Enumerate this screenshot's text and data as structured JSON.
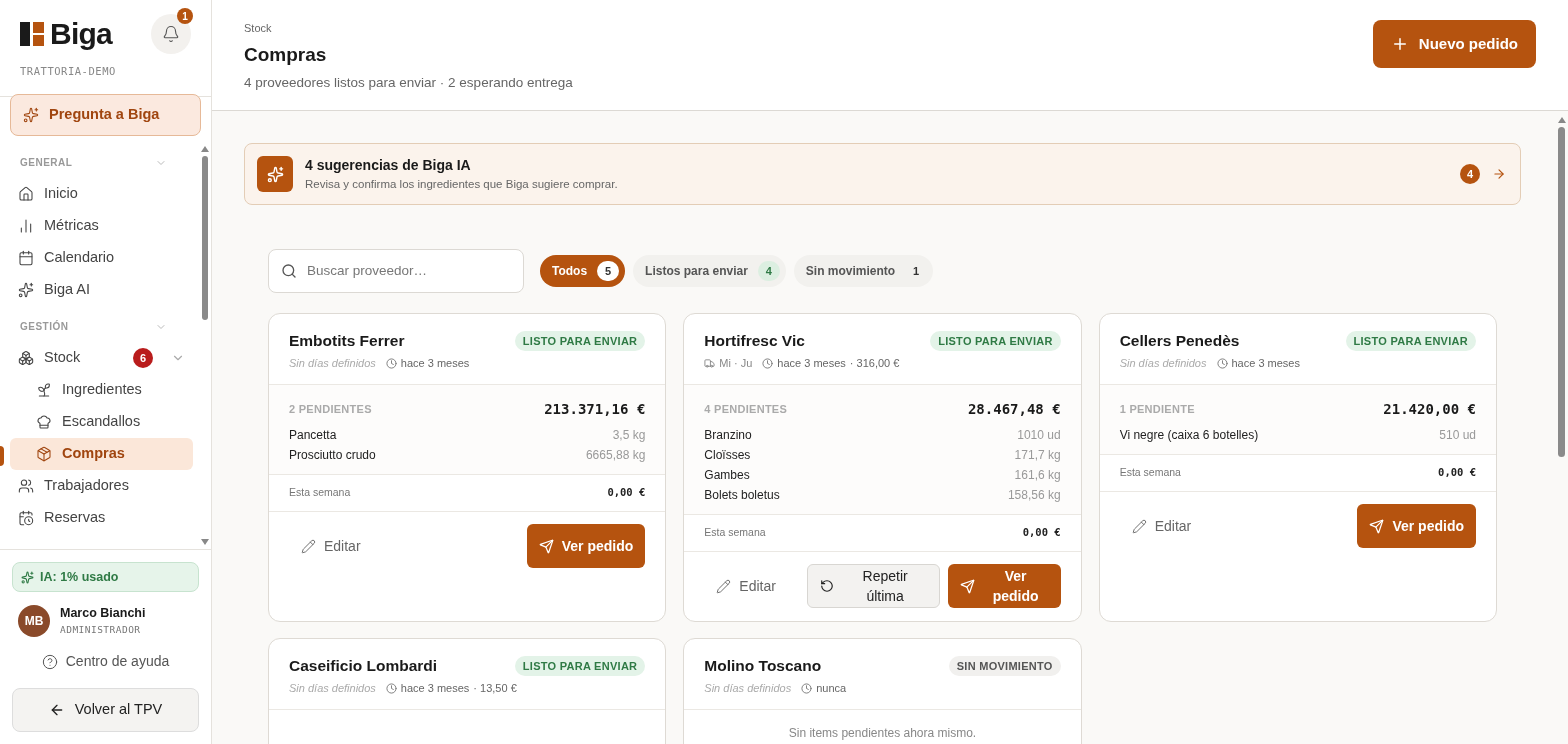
{
  "brand": {
    "name": "Biga",
    "tenant": "TRATTORIA-DEMO"
  },
  "notifications": {
    "count": "1"
  },
  "ask_button": "Pregunta a Biga",
  "nav_sections": [
    {
      "title": "GENERAL",
      "expanded": true,
      "items": [
        {
          "label": "Inicio",
          "selected": false
        },
        {
          "label": "Métricas",
          "selected": false
        },
        {
          "label": "Calendario",
          "selected": false
        },
        {
          "label": "Biga AI",
          "selected": false
        }
      ]
    },
    {
      "title": "GESTIÓN",
      "expanded": true,
      "items": [
        {
          "label": "Stock",
          "selected": false,
          "badge": "6",
          "expanded": true,
          "children": [
            {
              "label": "Ingredientes",
              "selected": false
            },
            {
              "label": "Escandallos",
              "selected": false
            },
            {
              "label": "Compras",
              "selected": true
            }
          ]
        },
        {
          "label": "Trabajadores",
          "selected": false
        },
        {
          "label": "Reservas",
          "selected": false
        }
      ]
    }
  ],
  "ai_usage": "IA: 1% usado",
  "user": {
    "initials": "MB",
    "name": "Marco Bianchi",
    "role": "ADMINISTRADOR"
  },
  "help_link": "Centro de ayuda",
  "back_button": "Volver al TPV",
  "header": {
    "breadcrumb": "Stock",
    "title": "Compras",
    "subtitle": "4 proveedores listos para enviar · 2 esperando entrega",
    "new_button": "Nuevo pedido"
  },
  "suggestions": {
    "title": "4 sugerencias de Biga IA",
    "text": "Revisa y confirma los ingredientes que Biga sugiere comprar.",
    "count": "4"
  },
  "search": {
    "placeholder": "Buscar proveedor…"
  },
  "filters": [
    {
      "label": "Todos",
      "count": "5",
      "selected": true,
      "kind": "neutral"
    },
    {
      "label": "Listos para enviar",
      "count": "4",
      "selected": false,
      "kind": "ready"
    },
    {
      "label": "Sin movimiento",
      "count": "1",
      "selected": false,
      "kind": "neutral"
    }
  ],
  "suppliers": [
    {
      "name": "Embotits Ferrer",
      "status": {
        "kind": "ready",
        "label": "LISTO PARA ENVIAR"
      },
      "schedule": {
        "kind": "none",
        "text": "Sin días definidos"
      },
      "last": "hace 3 meses",
      "pending_label": "2 PENDIENTES",
      "total": "213.371,16 €",
      "items": [
        {
          "name": "Pancetta",
          "qty": "3,5 kg"
        },
        {
          "name": "Prosciutto crudo",
          "qty": "6665,88 kg"
        }
      ],
      "week_label": "Esta semana",
      "week_total": "0,00 €",
      "edit": "Editar",
      "view": "Ver pedido"
    },
    {
      "name": "Hortifresc Vic",
      "status": {
        "kind": "ready",
        "label": "LISTO PARA ENVIAR"
      },
      "schedule": {
        "kind": "days",
        "text": "Mi · Ju"
      },
      "last": "hace 3 meses",
      "amount": "· 316,00 €",
      "pending_label": "4 PENDIENTES",
      "total": "28.467,48 €",
      "items": [
        {
          "name": "Branzino",
          "qty": "1010 ud"
        },
        {
          "name": "Cloïsses",
          "qty": "171,7 kg"
        },
        {
          "name": "Gambes",
          "qty": "161,6 kg"
        },
        {
          "name": "Bolets boletus",
          "qty": "158,56 kg"
        }
      ],
      "week_label": "Esta semana",
      "week_total": "0,00 €",
      "edit": "Editar",
      "repeat": "Repetir última",
      "view": "Ver pedido"
    },
    {
      "name": "Cellers Penedès",
      "status": {
        "kind": "ready",
        "label": "LISTO PARA ENVIAR"
      },
      "schedule": {
        "kind": "none",
        "text": "Sin días definidos"
      },
      "last": "hace 3 meses",
      "pending_label": "1 PENDIENTE",
      "total": "21.420,00 €",
      "items": [
        {
          "name": "Vi negre (caixa 6 botelles)",
          "qty": "510 ud"
        }
      ],
      "week_label": "Esta semana",
      "week_total": "0,00 €",
      "edit": "Editar",
      "view": "Ver pedido"
    },
    {
      "name": "Caseificio Lombardi",
      "status": {
        "kind": "ready",
        "label": "LISTO PARA ENVIAR"
      },
      "schedule": {
        "kind": "none",
        "text": "Sin días definidos"
      },
      "last": "hace 3 meses",
      "amount": "· 13,50 €"
    },
    {
      "name": "Molino Toscano",
      "status": {
        "kind": "idle",
        "label": "SIN MOVIMIENTO"
      },
      "schedule": {
        "kind": "none",
        "text": "Sin días definidos"
      },
      "last": "nunca",
      "empty": "Sin items pendientes ahora mismo."
    }
  ]
}
